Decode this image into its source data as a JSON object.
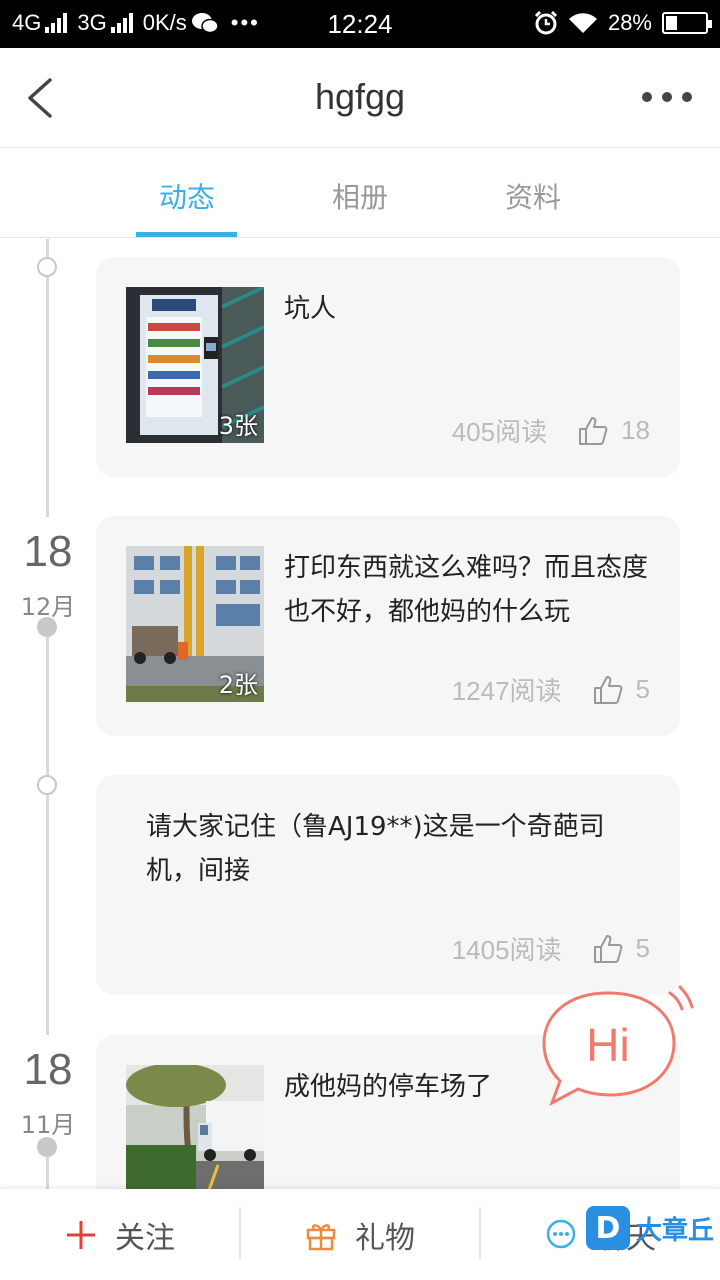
{
  "status_bar": {
    "network1": "4G",
    "network2": "3G",
    "speed": "0K/s",
    "time": "12:24",
    "battery": "28%",
    "battery_level": 0.28
  },
  "header": {
    "title": "hgfgg"
  },
  "tabs": [
    {
      "label": "动态",
      "active": true
    },
    {
      "label": "相册",
      "active": false
    },
    {
      "label": "资料",
      "active": false
    }
  ],
  "timeline": {
    "group1": {
      "day": "18",
      "month": "12月"
    },
    "group2": {
      "day": "18",
      "month": "11月"
    }
  },
  "posts": [
    {
      "text": "坑人",
      "photo_count": "3张",
      "reads": "405阅读",
      "likes": "18"
    },
    {
      "text": "打印东西就这么难吗？而且态度也不好，都他妈的什么玩",
      "photo_count": "2张",
      "reads": "1247阅读",
      "likes": "5"
    },
    {
      "text": "请大家记住（鲁AJ19**)这是一个奇葩司机，间接",
      "reads": "1405阅读",
      "likes": "5"
    },
    {
      "text": "成他妈的停车场了"
    }
  ],
  "hi_bubble": {
    "label": "Hi"
  },
  "bottom_bar": {
    "follow": "关注",
    "gift": "礼物",
    "chat": "聊天"
  },
  "watermark": {
    "badge": "D",
    "text": "大章丘"
  },
  "colors": {
    "accent": "#3bb0e8",
    "follow_red": "#e0403a",
    "gift_orange": "#f08a3c",
    "chat_blue": "#3bb0e8",
    "hi_red": "#f07a6e"
  }
}
